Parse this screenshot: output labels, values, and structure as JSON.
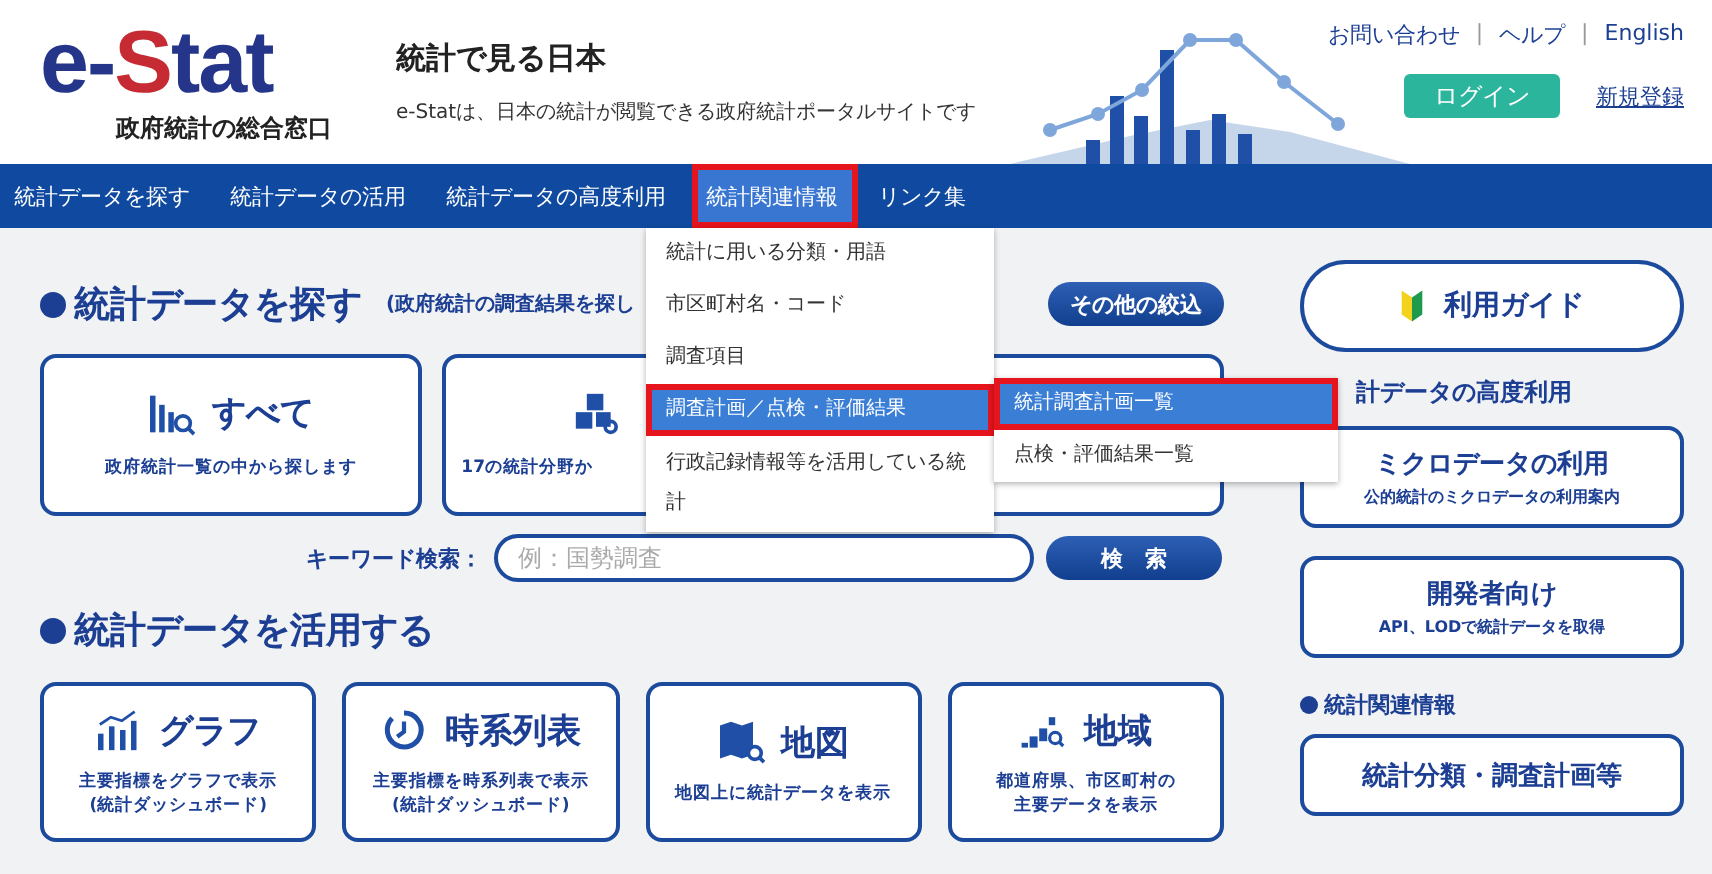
{
  "header": {
    "logo": {
      "main": "e-",
      "accent": "S",
      "rest": "tat",
      "tagline": "政府統計の総合窓口"
    },
    "title": "統計で見る日本",
    "subtitle": "e-Statは、日本の統計が閲覧できる政府統計ポータルサイトです",
    "links": [
      "お問い合わせ",
      "ヘルプ",
      "English"
    ],
    "link_separator": "|",
    "login": "ログイン",
    "register": "新規登録"
  },
  "nav": [
    {
      "label": "統計データを探す",
      "selected": false,
      "annotated": false
    },
    {
      "label": "統計データの活用",
      "selected": false,
      "annotated": false
    },
    {
      "label": "統計データの高度利用",
      "selected": false,
      "annotated": false
    },
    {
      "label": "統計関連情報",
      "selected": true,
      "annotated": true
    },
    {
      "label": "リンク集",
      "selected": false,
      "annotated": false
    }
  ],
  "dropdown": [
    {
      "label": "統計に用いる分類・用語",
      "selected": false,
      "annotated": false
    },
    {
      "label": "市区町村名・コード",
      "selected": false,
      "annotated": false
    },
    {
      "label": "調査項目",
      "selected": false,
      "annotated": false
    },
    {
      "label": "調査計画／点検・評価結果",
      "selected": true,
      "annotated": true
    },
    {
      "label": "行政記録情報等を活用している統計",
      "selected": false,
      "annotated": false
    }
  ],
  "submenu": [
    {
      "label": "統計調査計画一覧",
      "selected": true,
      "annotated": true
    },
    {
      "label": "点検・評価結果一覧",
      "selected": false,
      "annotated": false
    }
  ],
  "search": {
    "heading": "統計データを探す",
    "note": "(政府統計の調査結果を探し",
    "filter_button": "その他の絞込",
    "cards": [
      {
        "kind": "all",
        "title": "すべて",
        "text": "政府統計一覧の中から探します"
      },
      {
        "kind": "field",
        "text": "17の統計分野か"
      },
      {
        "kind": "hidden"
      }
    ],
    "keyword_label": "キーワード検索：",
    "placeholder": "例：国勢調査",
    "search_button": "検　索"
  },
  "use": {
    "heading": "統計データを活用する",
    "cards": [
      {
        "kind": "graph",
        "title": "グラフ",
        "lines": [
          "主要指標をグラフで表示",
          "(統計ダッシュボード)"
        ]
      },
      {
        "kind": "timeseries",
        "title": "時系列表",
        "lines": [
          "主要指標を時系列表で表示",
          "(統計ダッシュボード)"
        ]
      },
      {
        "kind": "map",
        "title": "地図",
        "lines": [
          "地図上に統計データを表示"
        ]
      },
      {
        "kind": "region",
        "title": "地域",
        "lines": [
          "都道府県、市区町村の",
          "主要データを表示"
        ]
      }
    ]
  },
  "side": {
    "guide": "利用ガイド",
    "advanced_heading": "計データの高度利用",
    "cards": [
      {
        "title": "ミクロデータの利用",
        "text": "公的統計のミクロデータの利用案内"
      },
      {
        "title": "開発者向け",
        "text": "API、LODで統計データを取得"
      }
    ],
    "related_heading": "統計関連情報",
    "related_button": "統計分類・調査計画等"
  }
}
